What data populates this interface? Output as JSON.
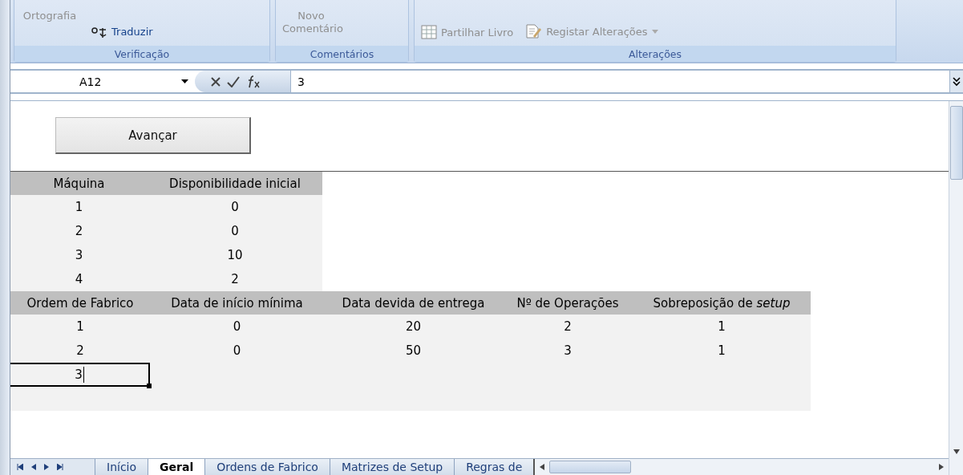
{
  "ribbon": {
    "groups": [
      {
        "label": "Verificação",
        "items": [
          {
            "label": "Ortografia",
            "kind": "large",
            "disabled": true
          },
          {
            "label": "Traduzir",
            "kind": "translate",
            "disabled": false
          }
        ]
      },
      {
        "label": "Comentários",
        "items": [
          {
            "label": "Novo Comentário",
            "kind": "large",
            "disabled": true
          }
        ]
      },
      {
        "label": "Alterações",
        "items": [
          {
            "label": "Partilhar Livro",
            "kind": "share",
            "disabled": true
          },
          {
            "label": "Registar Alterações",
            "kind": "track",
            "disabled": true
          }
        ]
      }
    ]
  },
  "formula_bar": {
    "name_box": "A12",
    "value": "3"
  },
  "button": "Avançar",
  "machines": {
    "columns": [
      "Máquina",
      "Disponibilidade inicial"
    ],
    "rows": [
      [
        "1",
        "0"
      ],
      [
        "2",
        "0"
      ],
      [
        "3",
        "10"
      ],
      [
        "4",
        "2"
      ]
    ]
  },
  "orders": {
    "columns": [
      "Ordem de Fabrico",
      "Data de início mínima",
      "Data devida de entrega",
      "Nº de Operações",
      "Sobreposição de *setup*"
    ],
    "rows": [
      [
        "1",
        "0",
        "20",
        "2",
        "1"
      ],
      [
        "2",
        "0",
        "50",
        "3",
        "1"
      ]
    ],
    "editing_cell": "3"
  },
  "sheet_tabs": [
    {
      "label": "Início",
      "selected": false
    },
    {
      "label": "Geral",
      "selected": true
    },
    {
      "label": "Ordens de Fabrico",
      "selected": false
    },
    {
      "label": "Matrizes de Setup",
      "selected": false
    },
    {
      "label": "Regras de",
      "selected": false
    }
  ]
}
